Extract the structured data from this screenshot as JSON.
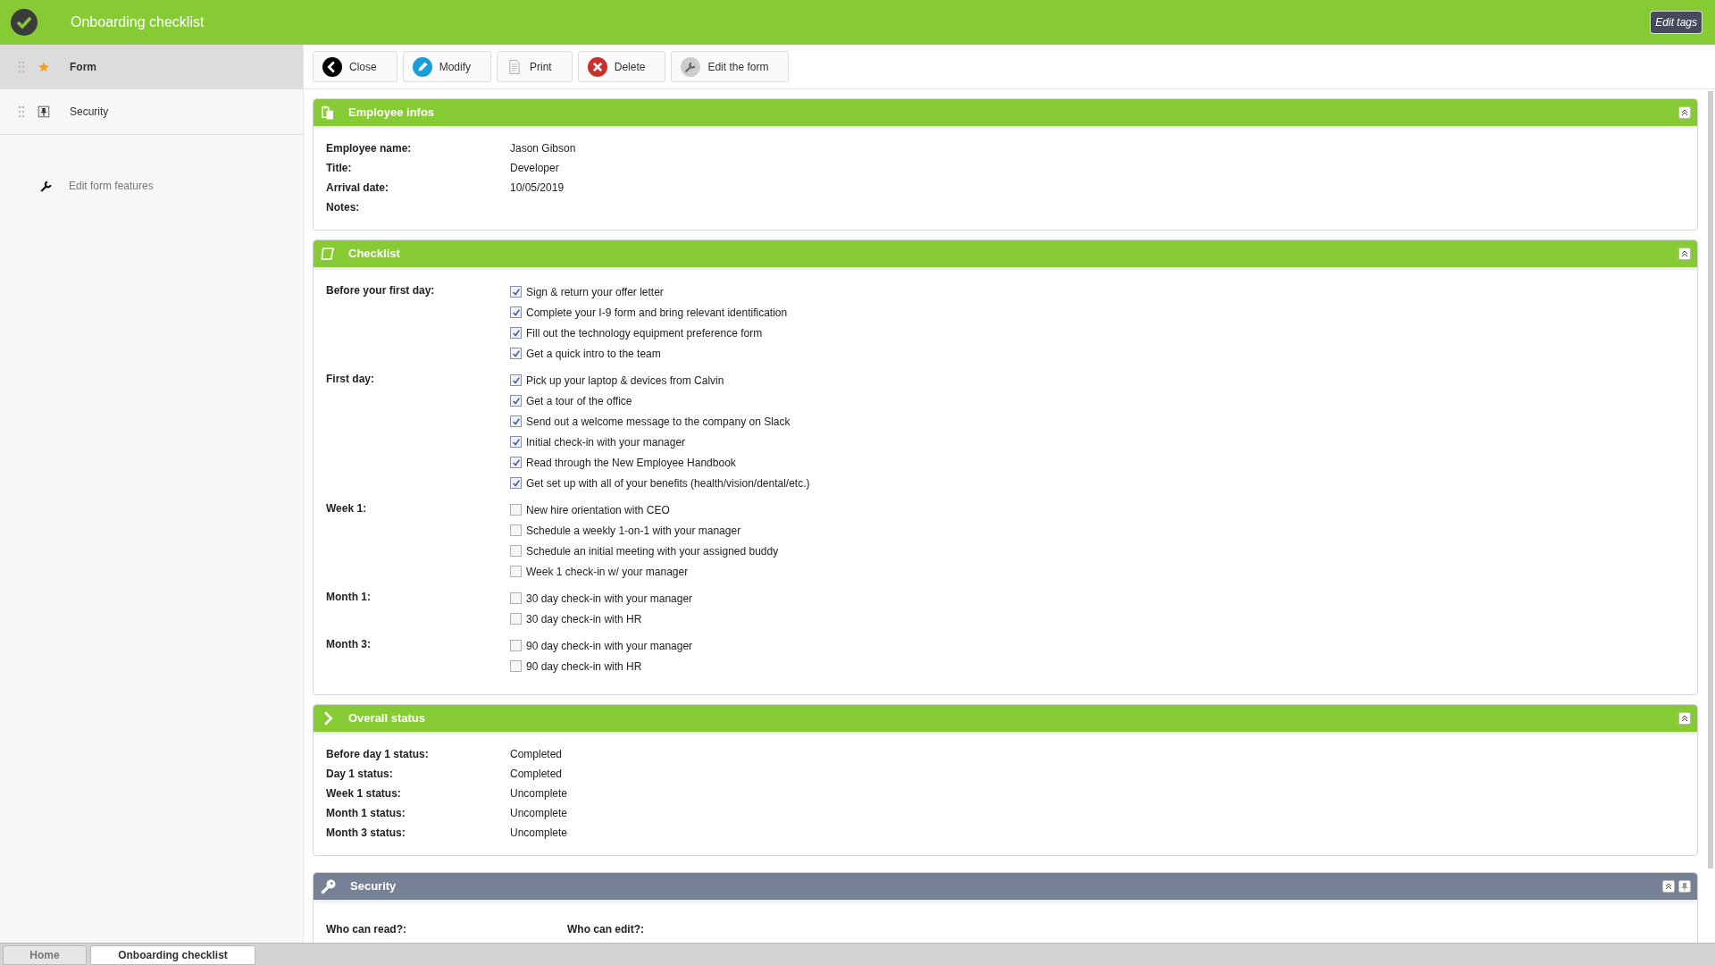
{
  "header": {
    "title": "Onboarding checklist",
    "edit_tags": "Edit tags"
  },
  "sidebar": {
    "items": [
      {
        "label": "Form",
        "selected": true
      },
      {
        "label": "Security",
        "selected": false
      }
    ],
    "footer_link": "Edit form features"
  },
  "toolbar": [
    {
      "label": "Close"
    },
    {
      "label": "Modify"
    },
    {
      "label": "Print"
    },
    {
      "label": "Delete"
    },
    {
      "label": "Edit the form"
    }
  ],
  "sections": [
    {
      "title": "Employee infos",
      "kind": "fields",
      "color": "#86cb33",
      "fields": [
        {
          "label": "Employee name:",
          "value": "Jason Gibson"
        },
        {
          "label": "Title:",
          "value": "Developer"
        },
        {
          "label": "Arrival date:",
          "value": "10/05/2019"
        },
        {
          "label": "Notes:"
        }
      ]
    },
    {
      "title": "Checklist",
      "kind": "checklist",
      "color": "#86cb33",
      "groups": [
        {
          "label": "Before your first day:",
          "items": [
            {
              "text": "Sign & return your offer letter",
              "checked": true
            },
            {
              "text": "Complete your I-9 form and bring relevant identification",
              "checked": true
            },
            {
              "text": "Fill out the technology equipment preference form",
              "checked": true
            },
            {
              "text": "Get a quick intro to the team",
              "checked": true
            }
          ]
        },
        {
          "label": "First day:",
          "items": [
            {
              "text": "Pick up your laptop & devices from Calvin",
              "checked": true
            },
            {
              "text": "Get a tour of the office",
              "checked": true
            },
            {
              "text": "Send out a welcome message to the company on Slack",
              "checked": true
            },
            {
              "text": "Initial check-in with your manager",
              "checked": true
            },
            {
              "text": "Read through the New Employee Handbook",
              "checked": true
            },
            {
              "text": "Get set up with all of your benefits (health/vision/dental/etc.)",
              "checked": true
            }
          ]
        },
        {
          "label": "Week 1:",
          "items": [
            {
              "text": "New hire orientation with CEO",
              "checked": false
            },
            {
              "text": "Schedule a weekly 1-on-1 with your manager",
              "checked": false
            },
            {
              "text": "Schedule an initial meeting with your assigned buddy",
              "checked": false
            },
            {
              "text": "Week 1 check-in w/ your manager",
              "checked": false
            }
          ]
        },
        {
          "label": "Month 1:",
          "items": [
            {
              "text": "30 day check-in with your manager",
              "checked": false
            },
            {
              "text": "30 day check-in with HR",
              "checked": false
            }
          ]
        },
        {
          "label": "Month 3:",
          "items": [
            {
              "text": "90 day check-in with your manager",
              "checked": false
            },
            {
              "text": "90 day check-in with HR",
              "checked": false
            }
          ]
        }
      ]
    },
    {
      "title": "Overall status",
      "kind": "fields",
      "color": "#86cb33",
      "fields": [
        {
          "label": "Before day 1 status:",
          "value": "Completed"
        },
        {
          "label": "Day 1 status:",
          "value": "Completed"
        },
        {
          "label": "Week 1 status:",
          "value": "Uncomplete"
        },
        {
          "label": "Month 1 status:",
          "value": "Uncomplete"
        },
        {
          "label": "Month 3 status:",
          "value": "Uncomplete"
        }
      ]
    },
    {
      "title": "Security",
      "kind": "columns",
      "color": "#778196",
      "labels": [
        "Who can read?:",
        "Who can edit?:"
      ]
    }
  ],
  "bottom_tabs": [
    {
      "label": "Home",
      "selected": false
    },
    {
      "label": "Onboarding checklist",
      "selected": true
    }
  ]
}
